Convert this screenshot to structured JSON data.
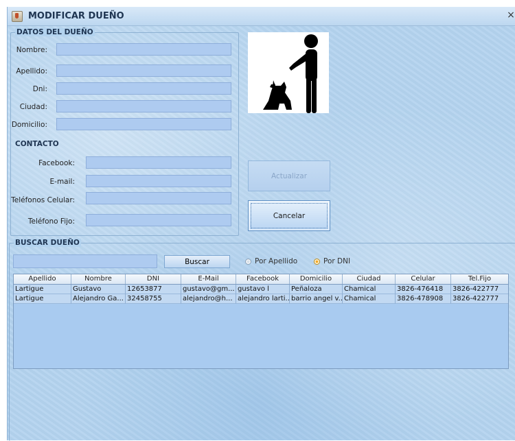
{
  "window": {
    "title": "MODIFICAR DUEÑO",
    "close_glyph": "×",
    "icon": "java-cup-icon"
  },
  "datos": {
    "section_title": "DATOS DEL DUEÑO",
    "fields": [
      {
        "label": "Nombre:",
        "value": ""
      },
      {
        "label": "Apellido:",
        "value": ""
      },
      {
        "label": "Dni:",
        "value": ""
      },
      {
        "label": "Ciudad:",
        "value": ""
      },
      {
        "label": "Domicilio:",
        "value": ""
      }
    ],
    "contacto_title": "CONTACTO",
    "contacto_fields": [
      {
        "label": "Facebook:",
        "value": ""
      },
      {
        "label": "E-mail:",
        "value": ""
      },
      {
        "label": "Teléfonos Celular:",
        "value": ""
      },
      {
        "label": "Teléfono Fijo:",
        "value": ""
      }
    ]
  },
  "picture": {
    "icon": "person-with-dog-icon"
  },
  "buttons": {
    "actualizar": "Actualizar",
    "cancelar": "Cancelar"
  },
  "buscar": {
    "section_title": "BUSCAR DUEÑO",
    "query": "",
    "button": "Buscar",
    "options": [
      {
        "label": "Por Apellido",
        "selected": false
      },
      {
        "label": "Por DNI",
        "selected": true
      }
    ]
  },
  "table": {
    "columns": [
      "Apellido",
      "Nombre",
      "DNI",
      "E-Mail",
      "Facebook",
      "Domicilio",
      "Ciudad",
      "Celular",
      "Tel.Fijo"
    ],
    "rows": [
      [
        "Lartigue",
        "Gustavo",
        "12653877",
        "gustavo@gm...",
        "gustavo l",
        "Peñaloza",
        "Chamical",
        "3826-476418",
        "3826-422777"
      ],
      [
        "Lartigue",
        "Alejandro Ga...",
        "32458755",
        "alejandro@h...",
        "alejandro larti...",
        "barrio angel v...",
        "Chamical",
        "3826-478908",
        "3826-422777"
      ]
    ]
  },
  "colors": {
    "background": "#b3d3ef",
    "field": "#aecbf0",
    "title_text": "#1f3552",
    "radio_selected": "#f3a928"
  }
}
